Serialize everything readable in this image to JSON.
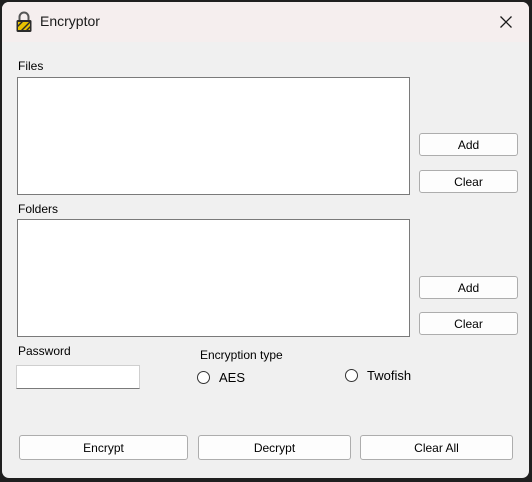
{
  "window": {
    "title": "Encryptor"
  },
  "files": {
    "label": "Files",
    "add_label": "Add",
    "clear_label": "Clear"
  },
  "folders": {
    "label": "Folders",
    "add_label": "Add",
    "clear_label": "Clear"
  },
  "password": {
    "label": "Password",
    "value": ""
  },
  "encryption_type": {
    "label": "Encryption type",
    "options": [
      {
        "label": "AES",
        "selected": false
      },
      {
        "label": "Twofish",
        "selected": false
      }
    ]
  },
  "actions": {
    "encrypt_label": "Encrypt",
    "decrypt_label": "Decrypt",
    "clear_all_label": "Clear All"
  }
}
